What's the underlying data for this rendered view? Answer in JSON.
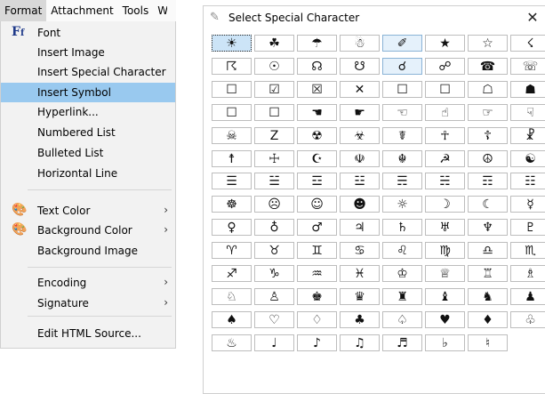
{
  "menubar": {
    "items": [
      {
        "label": "Format",
        "active": true
      },
      {
        "label": "Attachment",
        "active": false
      },
      {
        "label": "Tools",
        "active": false
      },
      {
        "label": "Wi",
        "active": false
      }
    ]
  },
  "format_menu": {
    "items": [
      {
        "label": "Font",
        "icon": "font-icon",
        "submenu": false,
        "selected": false
      },
      {
        "label": "Insert Image",
        "submenu": false,
        "selected": false
      },
      {
        "label": "Insert Special Character",
        "submenu": false,
        "selected": false
      },
      {
        "label": "Insert Symbol",
        "submenu": false,
        "selected": true
      },
      {
        "label": "Hyperlink...",
        "submenu": false,
        "selected": false
      },
      {
        "label": "Numbered List",
        "submenu": false,
        "selected": false
      },
      {
        "label": "Bulleted List",
        "submenu": false,
        "selected": false
      },
      {
        "label": "Horizontal Line",
        "submenu": false,
        "selected": false
      },
      {
        "label": "Text Color",
        "icon": "palette-icon",
        "submenu": true,
        "selected": false
      },
      {
        "label": "Background Color",
        "icon": "palette-icon",
        "submenu": true,
        "selected": false
      },
      {
        "label": "Background Image",
        "submenu": false,
        "selected": false
      },
      {
        "label": "Encoding",
        "submenu": true,
        "selected": false
      },
      {
        "label": "Signature",
        "submenu": true,
        "selected": false
      },
      {
        "label": "Edit HTML Source...",
        "submenu": false,
        "selected": false
      }
    ],
    "submenu_arrow": "›",
    "colors": {
      "selected_bg": "#99c9ef",
      "menu_bg": "#f2f2f2"
    }
  },
  "dialog": {
    "title": "Select Special Character",
    "title_icon": "pen-icon",
    "close_glyph": "✕",
    "selected_cell": [
      0,
      0
    ],
    "highlighted_cells": [
      [
        0,
        4
      ],
      [
        1,
        4
      ]
    ],
    "symbols": [
      [
        "☀",
        "☘",
        "☂",
        "☃",
        "✐",
        "★",
        "☆",
        "☇"
      ],
      [
        "☈",
        "☉",
        "☊",
        "☋",
        "☌",
        "☍",
        "☎",
        "☏"
      ],
      [
        "☐",
        "☑",
        "☒",
        "✕",
        "☐",
        "☐",
        "☖",
        "☗"
      ],
      [
        "☐",
        "☐",
        "☚",
        "☛",
        "☜",
        "☝",
        "☞",
        "☟"
      ],
      [
        "☠",
        "Z",
        "☢",
        "☣",
        "☤",
        "☥",
        "☦",
        "☧"
      ],
      [
        "☨",
        "☩",
        "☪",
        "☫",
        "☬",
        "☭",
        "☮",
        "☯"
      ],
      [
        "☰",
        "☱",
        "☲",
        "☳",
        "☴",
        "☵",
        "☶",
        "☷"
      ],
      [
        "☸",
        "☹",
        "☺",
        "☻",
        "☼",
        "☽",
        "☾",
        "☿"
      ],
      [
        "♀",
        "♁",
        "♂",
        "♃",
        "♄",
        "♅",
        "♆",
        "♇"
      ],
      [
        "♈",
        "♉",
        "♊",
        "♋",
        "♌",
        "♍",
        "♎",
        "♏"
      ],
      [
        "♐",
        "♑",
        "♒",
        "♓",
        "♔",
        "♕",
        "♖",
        "♗"
      ],
      [
        "♘",
        "♙",
        "♚",
        "♛",
        "♜",
        "♝",
        "♞",
        "♟"
      ],
      [
        "♠",
        "♡",
        "♢",
        "♣",
        "♤",
        "♥",
        "♦",
        "♧"
      ],
      [
        "♨",
        "♩",
        "♪",
        "♫",
        "♬",
        "♭",
        "♮",
        ""
      ]
    ]
  }
}
